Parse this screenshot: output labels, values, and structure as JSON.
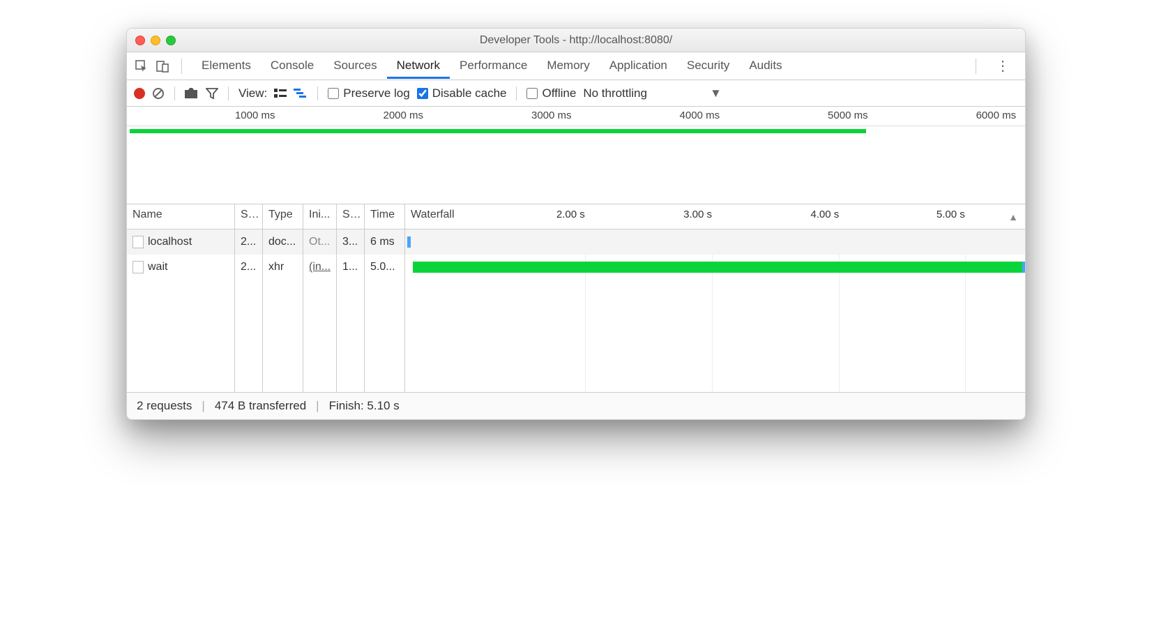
{
  "window": {
    "title": "Developer Tools - http://localhost:8080/"
  },
  "tabs": {
    "items": [
      "Elements",
      "Console",
      "Sources",
      "Network",
      "Performance",
      "Memory",
      "Application",
      "Security",
      "Audits"
    ],
    "active": "Network"
  },
  "toolbar": {
    "view_label": "View:",
    "preserve_log": "Preserve log",
    "disable_cache": "Disable cache",
    "offline": "Offline",
    "throttling": "No throttling"
  },
  "timeline": {
    "ticks": [
      "1000 ms",
      "2000 ms",
      "3000 ms",
      "4000 ms",
      "5000 ms",
      "6000 ms"
    ],
    "tick_positions_pct": [
      16.5,
      33,
      49.5,
      66,
      82.5,
      99
    ],
    "bar": {
      "left_pct": 0.3,
      "width_pct": 82
    }
  },
  "columns": {
    "name": "Name",
    "status": "S...",
    "type": "Type",
    "initiator": "Ini...",
    "size": "S...",
    "time": "Time",
    "waterfall": "Waterfall"
  },
  "waterfall_ticks": {
    "labels": [
      "2.00 s",
      "3.00 s",
      "4.00 s",
      "5.00 s"
    ],
    "positions_pct": [
      29,
      49.5,
      70,
      90.3
    ]
  },
  "requests": [
    {
      "name": "localhost",
      "status": "2...",
      "type": "doc...",
      "initiator": "Ot...",
      "size": "3...",
      "time": "6 ms",
      "wf": {
        "left_pct": 0.3,
        "width_pct": 0.6,
        "color": "#4aa3ff"
      }
    },
    {
      "name": "wait",
      "status": "2...",
      "type": "xhr",
      "initiator": "(in...",
      "size": "1...",
      "time": "5.0...",
      "wf": {
        "left_pct": 1.2,
        "width_pct": 98.5,
        "color": "#0bd43a",
        "tail": "#4aa3ff"
      }
    }
  ],
  "status": {
    "requests": "2 requests",
    "transferred": "474 B transferred",
    "finish": "Finish: 5.10 s"
  }
}
